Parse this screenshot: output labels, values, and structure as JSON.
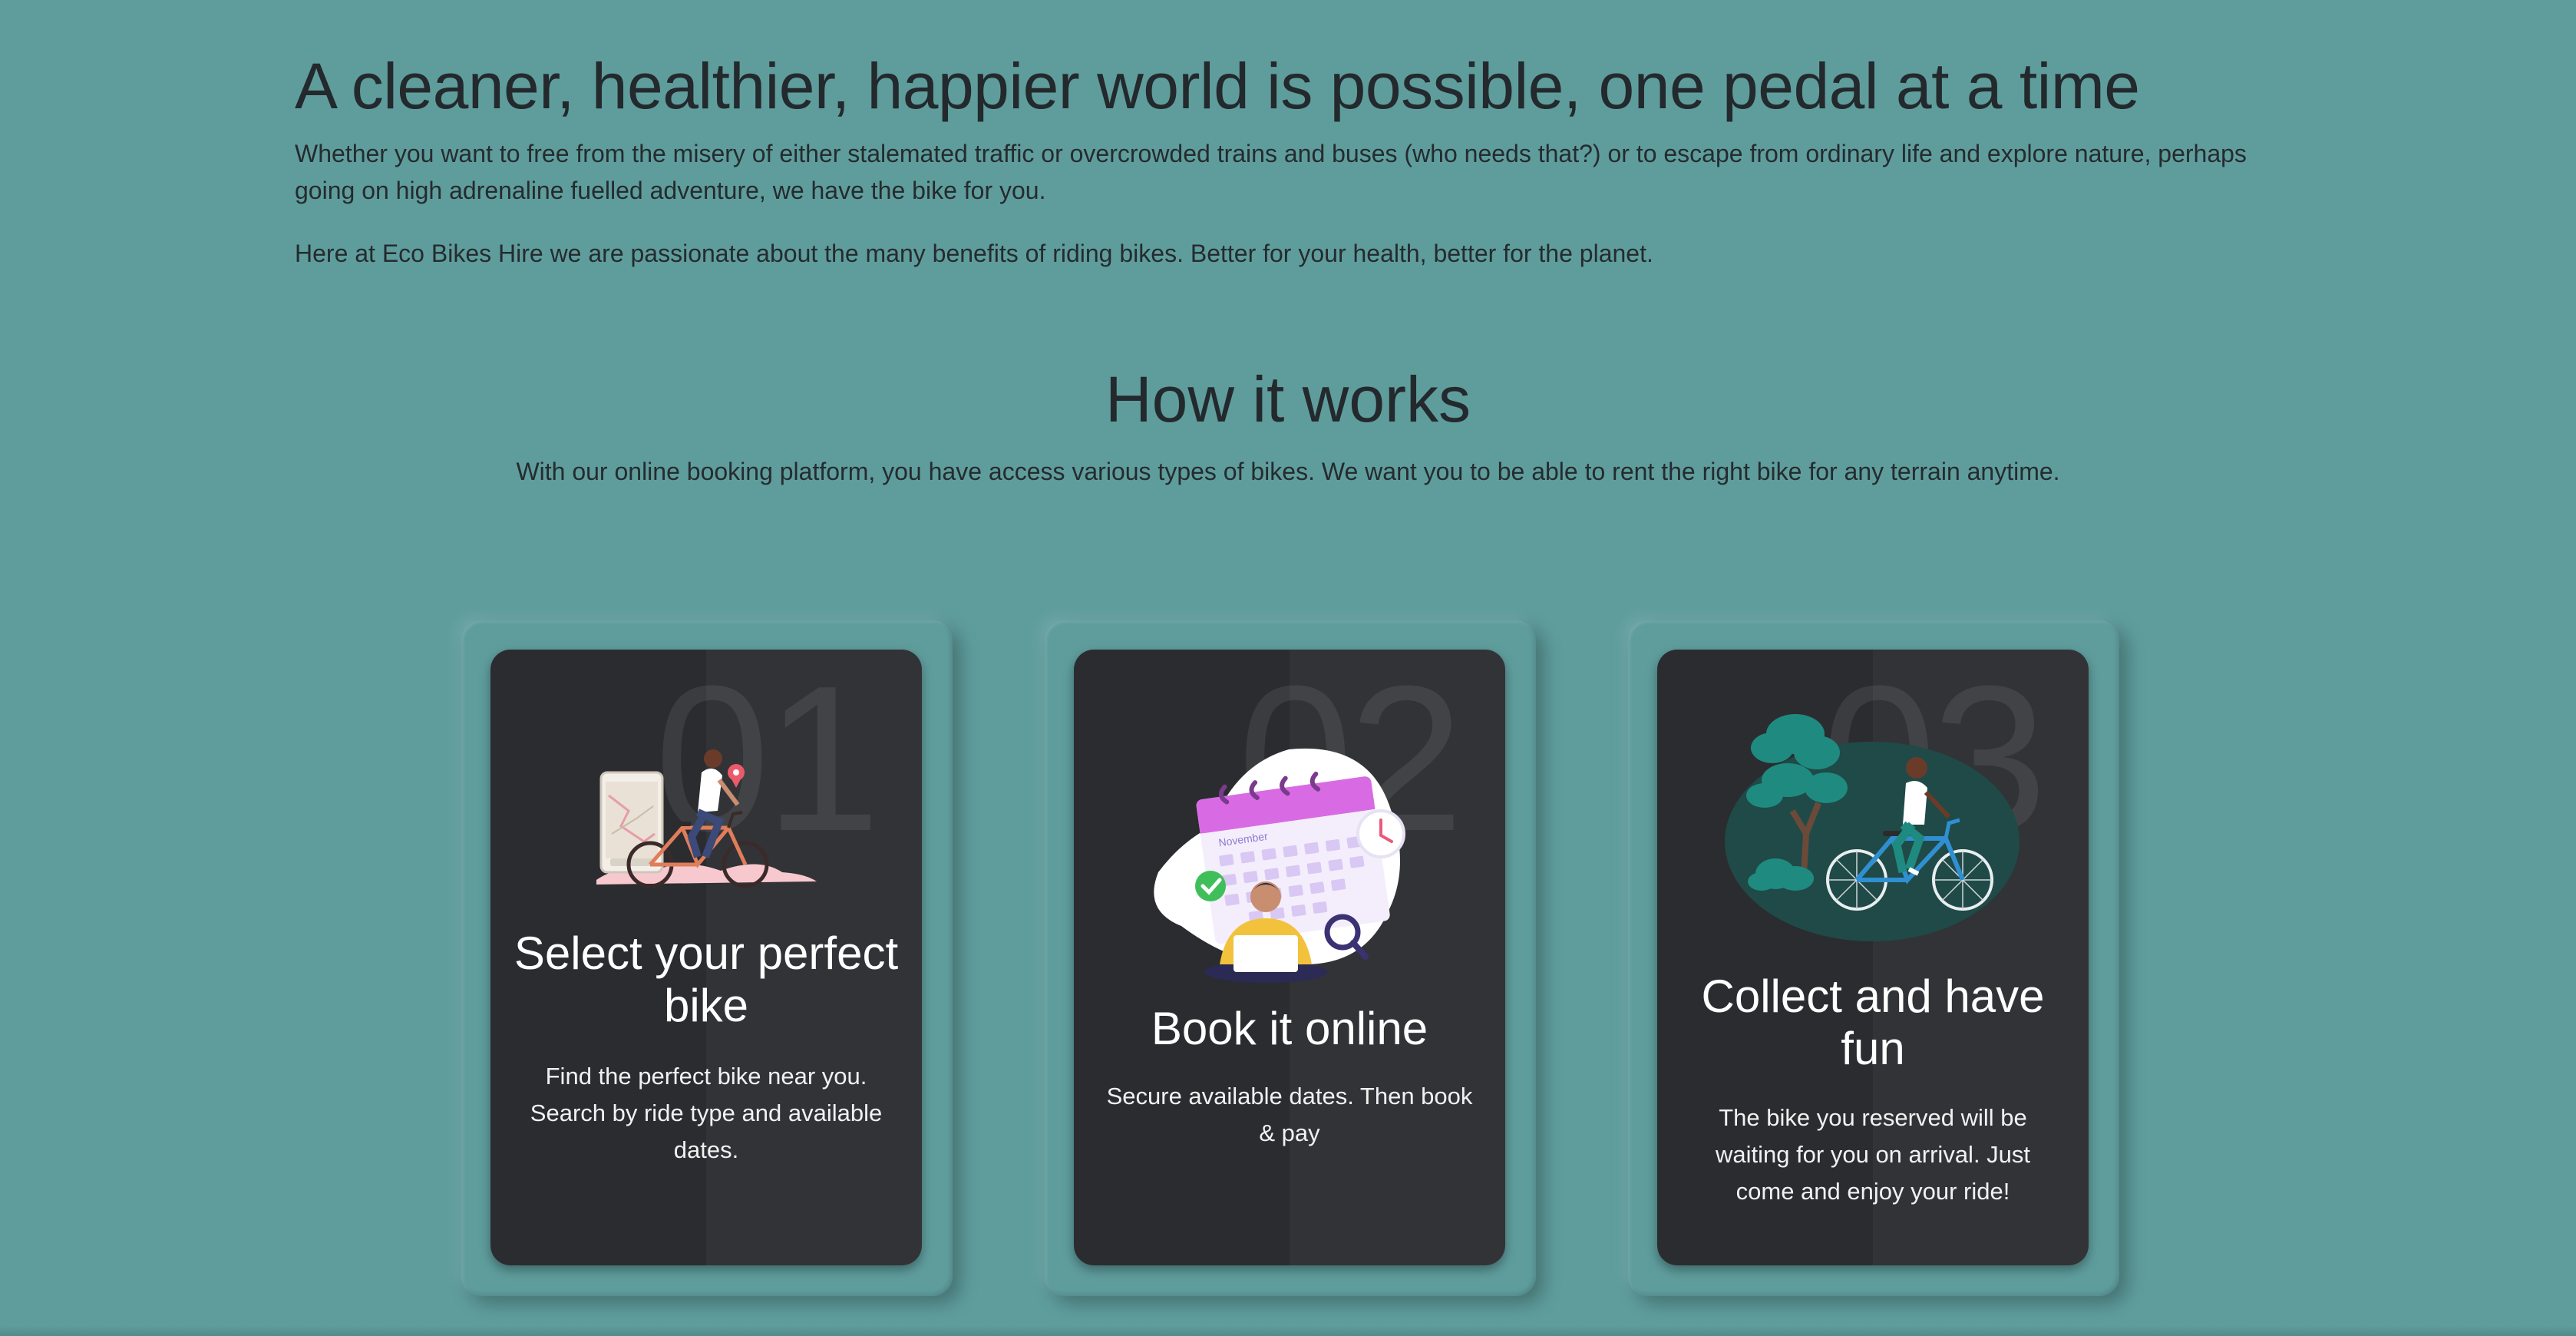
{
  "intro": {
    "title": "A cleaner, healthier, happier world is possible, one pedal at a time",
    "paragraph1": "Whether you want to free from the misery of either stalemated traffic or overcrowded trains and buses (who needs that?) or to escape from ordinary life and explore nature, perhaps going on high adrenaline fuelled adventure, we have the bike for you.",
    "paragraph2": "Here at Eco Bikes Hire we are passionate about the many benefits of riding bikes. Better for your health, better for the planet."
  },
  "how": {
    "title": "How it works",
    "subtitle": "With our online booking platform, you have access various types of bikes. We want you to be able to rent the right bike for any terrain anytime."
  },
  "steps": [
    {
      "number": "01",
      "title": "Select your perfect bike",
      "description": "Find the perfect bike near you. Search by ride type and available dates.",
      "icon": "bike-map-illustration"
    },
    {
      "number": "02",
      "title": "Book it online",
      "description": "Secure available dates. Then book & pay",
      "icon": "calendar-booking-illustration",
      "calendar_month": "November"
    },
    {
      "number": "03",
      "title": "Collect and have fun",
      "description": "The bike you reserved will be waiting for you on arrival. Just come and enjoy your ride!",
      "icon": "cyclist-nature-illustration"
    }
  ],
  "colors": {
    "background": "#5f9d9d",
    "card": "#2b2c30",
    "text_dark": "#23292c",
    "text_light": "#ffffff"
  }
}
